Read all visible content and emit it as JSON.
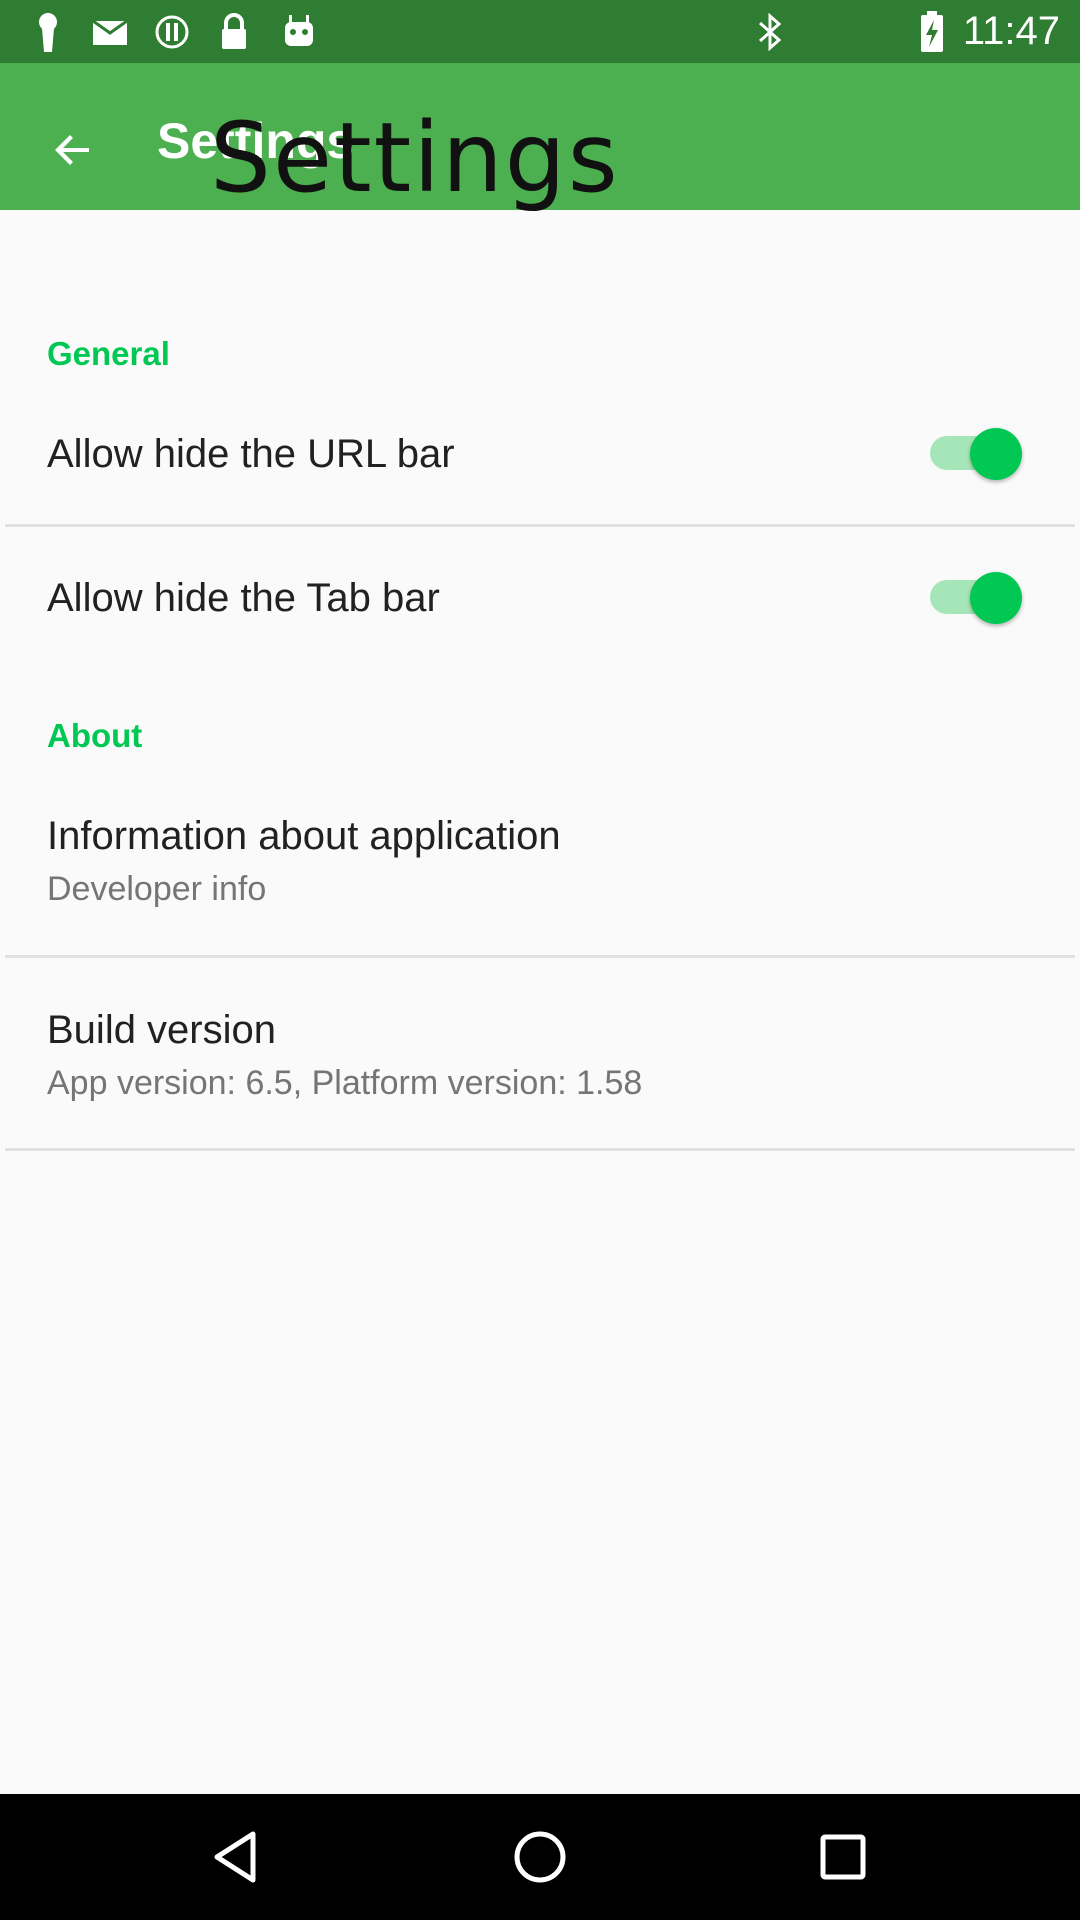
{
  "status_bar": {
    "time": "11:47",
    "icons": [
      "keyhole-icon",
      "mail-icon",
      "info-icon",
      "lock-icon",
      "android-icon",
      "bluetooth-icon",
      "battery-icon"
    ]
  },
  "app_bar": {
    "title": "Settings",
    "overlay_title": "Settings",
    "back_icon": "arrow-back-icon"
  },
  "sections": {
    "general": {
      "header": "General",
      "items": [
        {
          "title": "Allow hide the URL bar",
          "switch_on": true
        },
        {
          "title": "Allow hide the Tab bar",
          "switch_on": true
        }
      ]
    },
    "about": {
      "header": "About",
      "items": [
        {
          "title": "Information about application",
          "summary": "Developer info"
        },
        {
          "title": "Build version",
          "summary": "App version: 6.5, Platform version: 1.58"
        }
      ]
    }
  },
  "colors": {
    "status_bar": "#2e7d32",
    "app_bar": "#4caf50",
    "accent": "#00c853",
    "background": "#fafafa"
  },
  "nav_bar": {
    "icons": [
      "back-triangle-icon",
      "home-circle-icon",
      "recents-square-icon"
    ]
  }
}
